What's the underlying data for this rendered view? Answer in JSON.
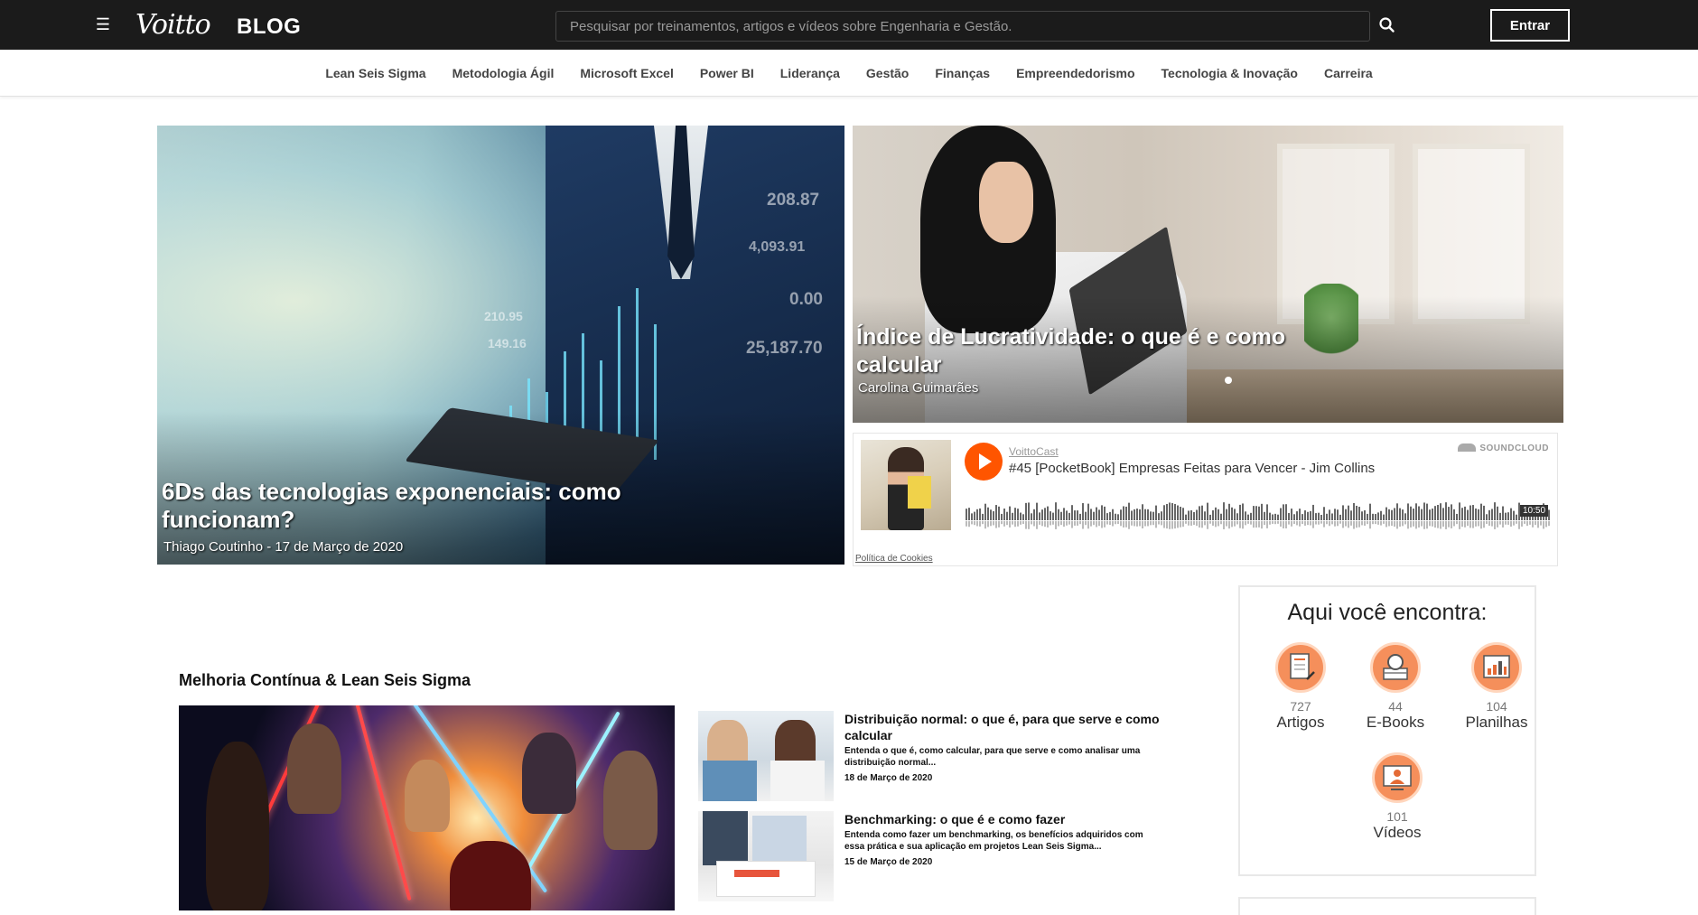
{
  "header": {
    "logo_text": "Voitto",
    "blog_label": "BLOG",
    "search_placeholder": "Pesquisar por treinamentos, artigos e vídeos sobre Engenharia e Gestão.",
    "login_label": "Entrar"
  },
  "categories": [
    "Lean Seis Sigma",
    "Metodologia Ágil",
    "Microsoft Excel",
    "Power BI",
    "Liderança",
    "Gestão",
    "Finanças",
    "Empreendedorismo",
    "Tecnologia & Inovação",
    "Carreira"
  ],
  "hero_main": {
    "title_line1": "6Ds das tecnologias exponenciais: como",
    "title_line2": "funcionam?",
    "meta": "Thiago Coutinho - 17 de Março de 2020",
    "overlay_numbers": [
      "208.87",
      "4,093.91",
      "0.00",
      "210.95",
      "149.16",
      "25,187.70"
    ]
  },
  "hero_side": {
    "title_line1": "Índice de Lucratividade: o que é e como",
    "title_line2": "calcular",
    "author": "Carolina Guimarães"
  },
  "soundcloud": {
    "user": "VoittoCast",
    "track": "#45 [PocketBook] Empresas Feitas para Vencer - Jim Collins",
    "brand": "SOUNDCLOUD",
    "duration": "10:50",
    "cookie_policy": "Política de Cookies"
  },
  "section": {
    "title": "Melhoria Contínua & Lean Seis Sigma",
    "articles": [
      {
        "title_line1": "Distribuição normal: o que é, para que serve e como",
        "title_line2": "calcular",
        "excerpt_line1": "Entenda o que é, como calcular, para que serve e como analisar uma",
        "excerpt_line2": "distribuição normal...",
        "date": "18 de Março de 2020"
      },
      {
        "title_line1": "Benchmarking: o que é e como fazer",
        "excerpt_line1": "Entenda como fazer um benchmarking, os benefícios adquiridos com",
        "excerpt_line2": "essa prática e sua aplicação em projetos Lean Seis Sigma...",
        "date": "15 de Março de 2020"
      }
    ]
  },
  "sidebar": {
    "title": "Aqui você encontra:",
    "resources": [
      {
        "count": "727",
        "label": "Artigos",
        "icon": "article-icon"
      },
      {
        "count": "44",
        "label": "E-Books",
        "icon": "ebook-search-icon"
      },
      {
        "count": "104",
        "label": "Planilhas",
        "icon": "spreadsheet-chart-icon"
      },
      {
        "count": "101",
        "label": "Vídeos",
        "icon": "video-icon"
      }
    ]
  },
  "colors": {
    "topbar": "#1b1b1b",
    "accent_orange": "#ff5500",
    "resource_icon": "#f58f5b"
  }
}
